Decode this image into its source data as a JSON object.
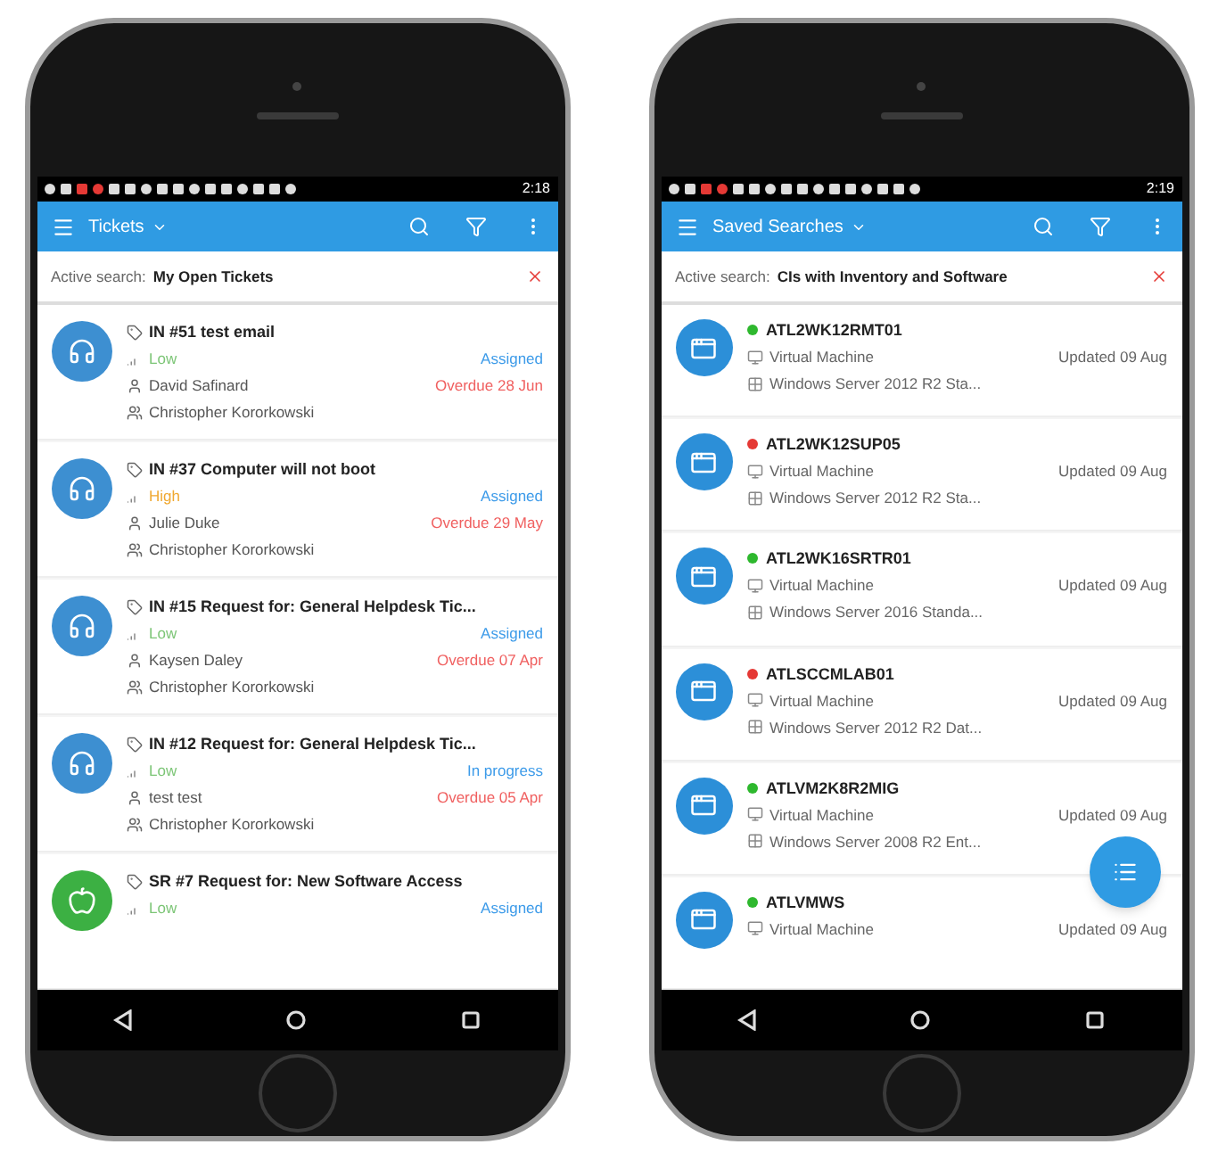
{
  "phones": [
    {
      "status_time": "2:18",
      "title": "Tickets",
      "active_search": {
        "label": "Active search:",
        "value": "My Open Tickets"
      },
      "kind": "tickets",
      "items": [
        {
          "kind": "incident",
          "color": "#3d8fd1",
          "title": "IN #51 test email",
          "priority": {
            "text": "Low",
            "color": "#7cc576"
          },
          "status": "Assigned",
          "requester": "David Safinard",
          "due": "Overdue 28 Jun",
          "assignee": "Christopher Kororkowski"
        },
        {
          "kind": "incident",
          "color": "#3d8fd1",
          "title": "IN #37 Computer will not boot",
          "priority": {
            "text": "High",
            "color": "#f0a830"
          },
          "status": "Assigned",
          "requester": "Julie Duke",
          "due": "Overdue 29 May",
          "assignee": "Christopher Kororkowski"
        },
        {
          "kind": "incident",
          "color": "#3d8fd1",
          "title": "IN #15 Request for: General Helpdesk Tic...",
          "priority": {
            "text": "Low",
            "color": "#7cc576"
          },
          "status": "Assigned",
          "requester": "Kaysen Daley",
          "due": "Overdue 07 Apr",
          "assignee": "Christopher Kororkowski"
        },
        {
          "kind": "incident",
          "color": "#3d8fd1",
          "title": "IN #12 Request for: General Helpdesk Tic...",
          "priority": {
            "text": "Low",
            "color": "#7cc576"
          },
          "status": "In progress",
          "requester": "test test",
          "due": "Overdue 05 Apr",
          "assignee": "Christopher Kororkowski"
        },
        {
          "kind": "request",
          "color": "#3cb043",
          "title": "SR #7 Request for: New Software Access",
          "priority": {
            "text": "Low",
            "color": "#7cc576"
          },
          "status": "Assigned"
        }
      ]
    },
    {
      "status_time": "2:19",
      "title": "Saved Searches",
      "active_search": {
        "label": "Active search:",
        "value": "CIs with Inventory and Software"
      },
      "kind": "assets",
      "fab": true,
      "items": [
        {
          "color": "#2eb82e",
          "name": "ATL2WK12RMT01",
          "type": "Virtual Machine",
          "updated": "Updated 09 Aug",
          "os": "Windows Server 2012 R2 Sta..."
        },
        {
          "color": "#e53935",
          "name": "ATL2WK12SUP05",
          "type": "Virtual Machine",
          "updated": "Updated 09 Aug",
          "os": "Windows Server 2012 R2 Sta..."
        },
        {
          "color": "#2eb82e",
          "name": "ATL2WK16SRTR01",
          "type": "Virtual Machine",
          "updated": "Updated 09 Aug",
          "os": "Windows Server 2016 Standa..."
        },
        {
          "color": "#e53935",
          "name": "ATLSCCMLAB01",
          "type": "Virtual Machine",
          "updated": "Updated 09 Aug",
          "os": "Windows Server 2012 R2 Dat..."
        },
        {
          "color": "#2eb82e",
          "name": "ATLVM2K8R2MIG",
          "type": "Virtual Machine",
          "updated": "Updated 09 Aug",
          "os": "Windows Server 2008 R2 Ent..."
        },
        {
          "color": "#2eb82e",
          "name": "ATLVMWS",
          "type": "Virtual Machine",
          "updated": "Updated 09 Aug"
        }
      ]
    }
  ]
}
